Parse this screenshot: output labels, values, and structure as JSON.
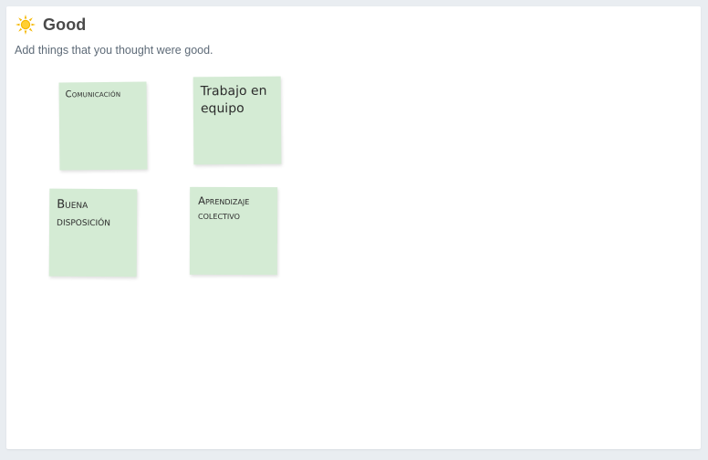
{
  "column": {
    "icon": "sun-icon",
    "title": "Good",
    "subtitle": "Add things that you thought were good."
  },
  "notes": [
    {
      "text": "Comunicación"
    },
    {
      "text": "Trabajo en equipo"
    },
    {
      "text": "Buena disposición"
    },
    {
      "text": "Aprendizaje colectivo"
    }
  ],
  "colors": {
    "note_background": "#d4ebd4",
    "sun": "#f5b800",
    "title": "#4a4a4a"
  }
}
